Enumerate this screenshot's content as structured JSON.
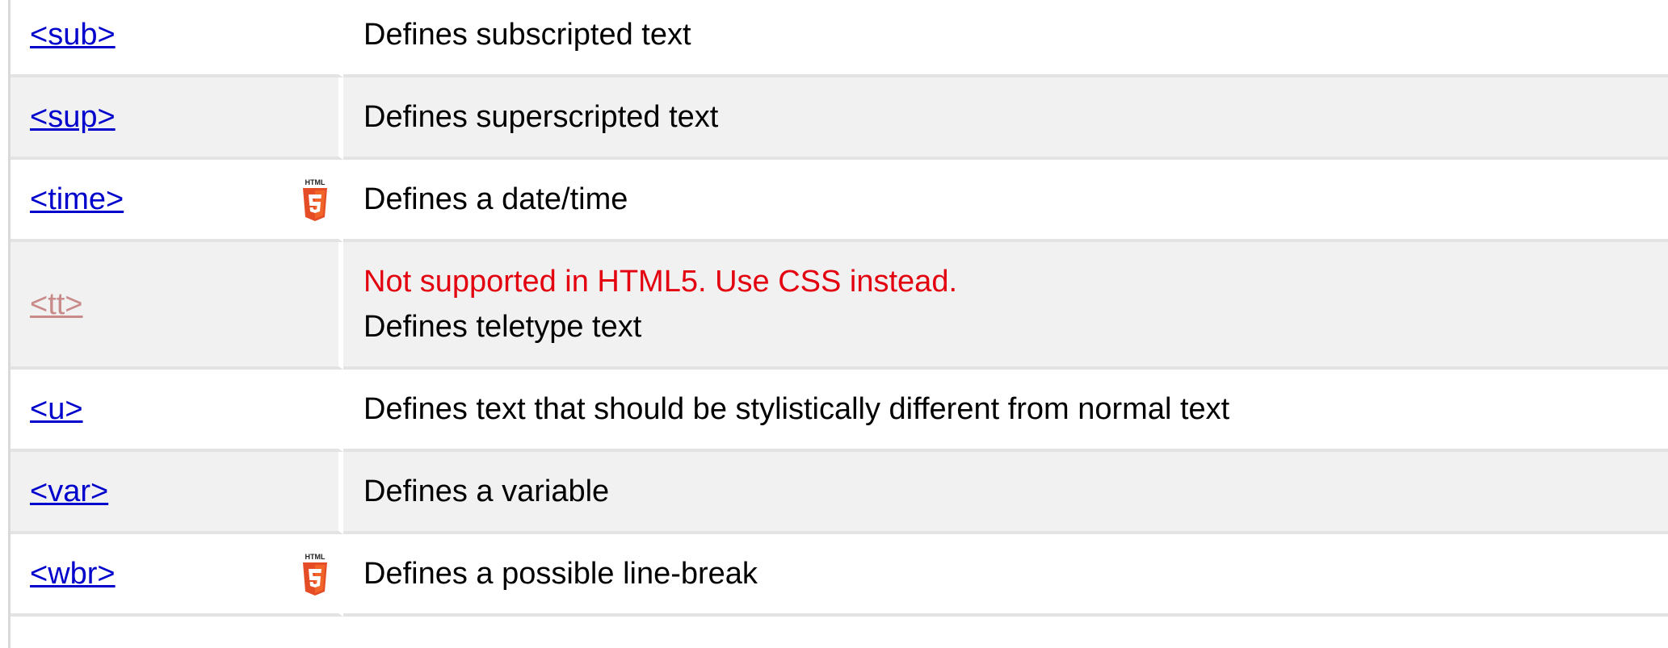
{
  "rows": [
    {
      "tag": "<sub>",
      "desc": "Defines subscripted text"
    },
    {
      "tag": "<sup>",
      "desc": "Defines superscripted text"
    },
    {
      "tag": "<time>",
      "desc": "Defines a date/time",
      "html5_badge": "HTML"
    },
    {
      "tag": "<tt>",
      "note": "Not supported in HTML5. Use CSS instead.",
      "desc": "Defines teletype text"
    },
    {
      "tag": "<u>",
      "desc": "Defines text that should be stylistically different from normal text"
    },
    {
      "tag": "<var>",
      "desc": "Defines a variable"
    },
    {
      "tag": "<wbr>",
      "desc": "Defines a possible line-break",
      "html5_badge": "HTML"
    }
  ],
  "icons": {
    "html5": "html5-icon"
  },
  "colors": {
    "link": "#0000cc",
    "deprecated_link": "#c98a8a",
    "warning": "#e3000f",
    "alt_row": "#f1f1f1",
    "html5_orange": "#e44d26"
  }
}
